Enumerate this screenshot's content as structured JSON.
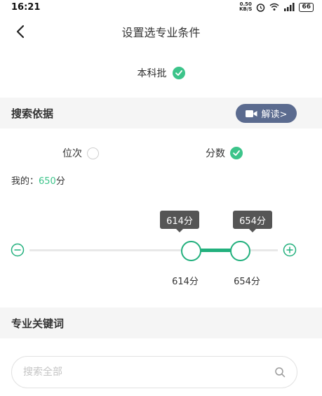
{
  "status_bar": {
    "time": "16:21",
    "net_speed_top": "0.50",
    "net_speed_bottom": "KB/S",
    "battery": "66"
  },
  "nav": {
    "title": "设置选专业条件",
    "back_icon": "chevron-left-icon"
  },
  "batch": {
    "label": "本科批",
    "checked": true
  },
  "search_basis": {
    "title": "搜索依据",
    "explain_button": "解读>",
    "explain_icon": "video-camera-icon",
    "options": [
      {
        "label": "位次",
        "checked": false
      },
      {
        "label": "分数",
        "checked": true
      }
    ],
    "my_score_prefix": "我的：",
    "my_score_value": "650",
    "my_score_unit": "分"
  },
  "score_range": {
    "low": "614分",
    "high": "654分",
    "low_value": 614,
    "high_value": 654
  },
  "keywords": {
    "title": "专业关键词",
    "search_placeholder": "搜索全部",
    "search_value": ""
  },
  "colors": {
    "accent_green": "#22b07d",
    "check_green": "#3cc48a",
    "explain_button_bg": "#5b6b8f"
  }
}
